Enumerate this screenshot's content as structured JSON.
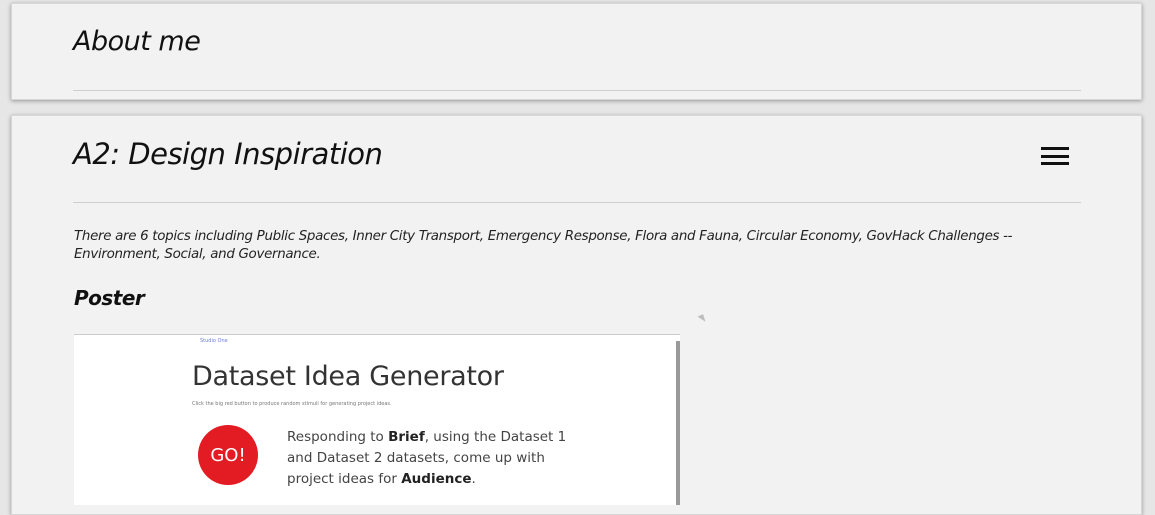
{
  "about_card": {
    "title": "About me"
  },
  "inspiration_card": {
    "title": "A2: Design Inspiration",
    "menu_icon": "hamburger-menu-icon",
    "intro": "There are 6 topics including Public Spaces, Inner City Transport, Emergency Response, Flora and Fauna, Circular Economy, GovHack Challenges -- Environment, Social, and Governance.",
    "section_heading": "Poster",
    "poster": {
      "studio_label": "Studio One",
      "title": "Dataset Idea Generator",
      "subtitle": "Click the big red button to produce random stimuli for generating project ideas.",
      "go_label": "GO!",
      "go_color": "#e31b23",
      "prompt_prefix": "Responding to ",
      "prompt_brief": "Brief",
      "prompt_middle": ", using the Dataset 1 and Dataset 2 datasets, come up with project ideas for ",
      "prompt_audience": "Audience",
      "prompt_suffix": "."
    }
  }
}
